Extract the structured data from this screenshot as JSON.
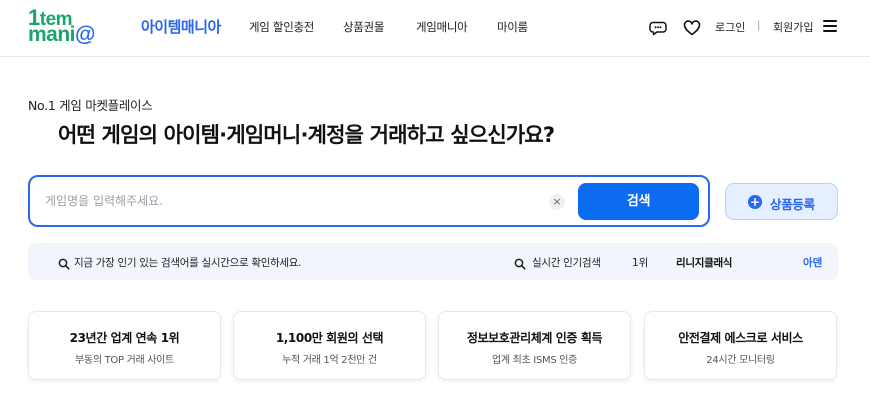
{
  "header": {
    "logo_line1_prefix": "1",
    "logo_line1": "tem",
    "logo_line2": "mani",
    "logo_line2_suffix": "@",
    "brand_name": "아이템매니아",
    "nav": [
      "게임 할인충전",
      "상품권몰",
      "게임매니아",
      "마이룸"
    ],
    "login": "로그인",
    "separator": "|",
    "join": "회원가입",
    "icons": [
      "chat-icon",
      "heart-icon",
      "menu-icon"
    ]
  },
  "hero": {
    "eyebrow": "No.1 게임 마켓플레이스",
    "headline": "어떤 게임의 아이템·게임머니·계정을 거래하고 싶으신가요?"
  },
  "search": {
    "placeholder": "게임명을 입력해주세요.",
    "value": "",
    "clear_symbol": "×",
    "button_label": "검색"
  },
  "register": {
    "icon_symbol": "+",
    "label": "상품등록"
  },
  "trending": {
    "hint": "지금 가장 인기 있는 검색어를 실시간으로 확인하세요.",
    "label": "실시간 인기검색",
    "rank": "1위",
    "keyword": "리니지클래식",
    "time": "아덴"
  },
  "features": [
    {
      "title": "23년간 업계 연속 1위",
      "subtitle": "부동의 TOP 거래 사이트"
    },
    {
      "title": "1,100만 회원의 선택",
      "subtitle": "누적 거래 1억 2천만 건"
    },
    {
      "title": "정보보호관리체계 인증 획득",
      "subtitle": "업계 최초 ISMS 인증"
    },
    {
      "title": "안전결제 에스크로 서비스",
      "subtitle": "24시간 모니터링"
    }
  ],
  "colors": {
    "brand_green": "#1aa56c",
    "brand_blue": "#2867f0",
    "search_button": "#0b6cf2",
    "trend_bg": "#f2f6fc"
  }
}
